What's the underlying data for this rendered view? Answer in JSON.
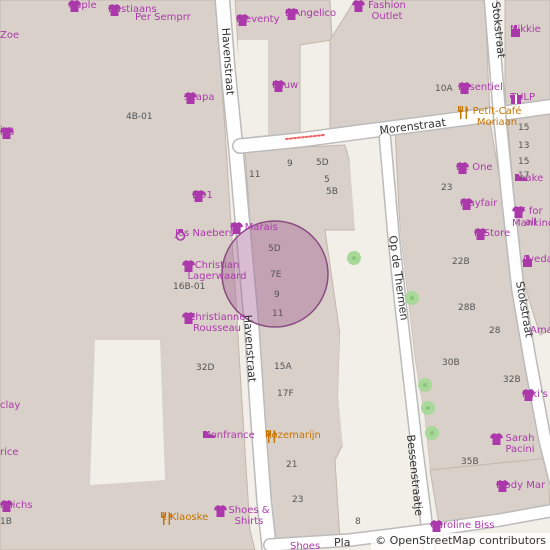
{
  "map": {
    "colors": {
      "building": "#d9d0c9",
      "outline": "#c4b6ab",
      "road": "#ffffff",
      "road_casing": "#bbbbbb",
      "background": "#f2efe9",
      "shop": "#ac39ac",
      "food": "#c77400",
      "marker": "#a86a9c"
    },
    "streets": [
      {
        "name": "Havenstraat",
        "key": "havenstraat_n"
      },
      {
        "name": "Havenstraat",
        "key": "havenstraat_s"
      },
      {
        "name": "Morenstraat",
        "key": "morenstraat"
      },
      {
        "name": "Op de Thermen",
        "key": "op_de_thermen"
      },
      {
        "name": "Bessenstraatje",
        "key": "bessenstraatje"
      },
      {
        "name": "Stokstraat",
        "key": "stokstraat_n"
      },
      {
        "name": "Stokstraat",
        "key": "stokstraat_s"
      },
      {
        "name": "Pla",
        "key": "plein"
      }
    ],
    "shops": [
      {
        "name": "Cuple",
        "icon": "shirt-icon"
      },
      {
        "name": "Bastiaans",
        "icon": "shirt-icon"
      },
      {
        "name": "Per Semprr",
        "icon": ""
      },
      {
        "name": "Eleventy",
        "icon": "shirt-icon"
      },
      {
        "name": "L'Angelico",
        "icon": "shirt-icon"
      },
      {
        "name": "Fashion Outlet",
        "icon": "shirt-icon"
      },
      {
        "name": "Nikkie",
        "icon": "perfume-icon"
      },
      {
        "name": "Zoe",
        "icon": ""
      },
      {
        "name": "Scapa",
        "icon": "shirt-icon"
      },
      {
        "name": "Pauw",
        "icon": "shirt-icon"
      },
      {
        "name": "Essentiel",
        "icon": "shirt-icon"
      },
      {
        "name": "TULP",
        "icon": "gift-icon"
      },
      {
        "name": "ica",
        "icon": ""
      },
      {
        "name": "Be One",
        "icon": "shirt-icon"
      },
      {
        "name": "BO1",
        "icon": "shirt-icon"
      },
      {
        "name": "Loake",
        "icon": "shoe-icon"
      },
      {
        "name": "Mayfair",
        "icon": "shirt-icon"
      },
      {
        "name": "7 for all",
        "icon": "shirt-icon"
      },
      {
        "name": "Mankind",
        "icon": ""
      },
      {
        "name": "Jos Naebers",
        "icon": "jewelry-icon"
      },
      {
        "name": "Le Marais",
        "icon": "shirt-icon"
      },
      {
        "name": "K Store",
        "icon": "shirt-icon"
      },
      {
        "name": "Christian Lagerwaard",
        "icon": "shirt-icon"
      },
      {
        "name": "Aveda",
        "icon": "perfume-icon"
      },
      {
        "name": "Christianne Rousseau",
        "icon": "shirt-icon"
      },
      {
        "name": "Ama",
        "icon": ""
      },
      {
        "name": "Kiki's",
        "icon": "shirt-icon"
      },
      {
        "name": "Monfrance",
        "icon": "shoe-icon"
      },
      {
        "name": "Sarah Pacini",
        "icon": "shirt-icon"
      },
      {
        "name": "clay",
        "icon": ""
      },
      {
        "name": "rice",
        "icon": ""
      },
      {
        "name": "Mody Mar",
        "icon": "shirt-icon"
      },
      {
        "name": "nnichs",
        "icon": "shirt-icon"
      },
      {
        "name": "Shoes & Shirts",
        "icon": "shirt-icon"
      },
      {
        "name": "Caroline Biss",
        "icon": "shirt-icon"
      },
      {
        "name": "Shoes",
        "icon": ""
      },
      {
        "name": "ica",
        "icon": "shirt-icon"
      }
    ],
    "food": [
      {
        "name": "Petit-Café Moriaan",
        "icon": "restaurant-icon"
      },
      {
        "name": "Rozemarijn",
        "icon": "restaurant-icon"
      },
      {
        "name": "'t Klaoske",
        "icon": "restaurant-icon"
      }
    ],
    "house_numbers": [
      "4B-01",
      "9",
      "5D",
      "5",
      "5B",
      "11",
      "23",
      "10A",
      "13",
      "15",
      "17",
      "22B",
      "16B-01",
      "5D",
      "7E",
      "9",
      "11",
      "28B",
      "28",
      "32D",
      "30B",
      "15A",
      "17F",
      "32B",
      "21",
      "35B",
      "23",
      "8",
      "1B",
      "15"
    ]
  },
  "attribution": {
    "symbol": "©",
    "text": "OpenStreetMap contributors"
  }
}
